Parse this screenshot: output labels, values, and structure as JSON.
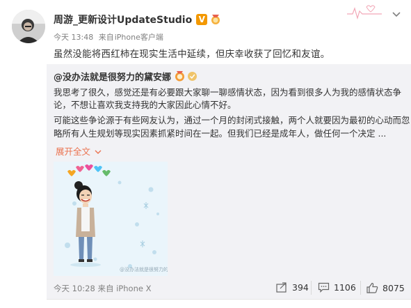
{
  "post": {
    "author": "周游_更新设计UpdateStudio",
    "verified_badge": "V",
    "time": "今天 13:48",
    "source_prefix": "来自",
    "source": "iPhone客户端",
    "text": "虽然没能将西红柿在现实生活中延续，但庆幸收获了回忆和友谊。"
  },
  "original": {
    "author": "@没办法就是很努力的黛安娜",
    "paragraph1_line1": "我思考了很久，感觉还是有必要跟大家聊一聊感情状态，因为看到很多人为我的感情状态争",
    "paragraph1_line2": "论，不想让喜欢我支持我的大家因此心情不好。",
    "paragraph2_line1": "可能这些争论源于有些网友认为，通过一个月的封闭式接触，两个人就要因为最初的心动而忽",
    "paragraph2_line2": "略所有人生规划等现实因素抓紧时间在一起。但我们已经是成年人，做任何一个决定 ...",
    "expand_label": "展开全文",
    "image_watermark": "@没办法就是很努力的黛安娜",
    "time": "今天 10:28",
    "source_prefix": "来自",
    "source": "iPhone X",
    "repost_count": "394",
    "comment_count": "1106",
    "like_count": "8075"
  },
  "colors": {
    "accent_orange": "#eb7350",
    "quote_bg": "#f2f2f5",
    "meta_gray": "#808080",
    "verified_orange": "#f39800"
  },
  "icons": [
    "avatar",
    "verified-v-icon",
    "medal-icon",
    "chevron-down-icon",
    "repost-icon",
    "comment-icon",
    "like-icon"
  ]
}
